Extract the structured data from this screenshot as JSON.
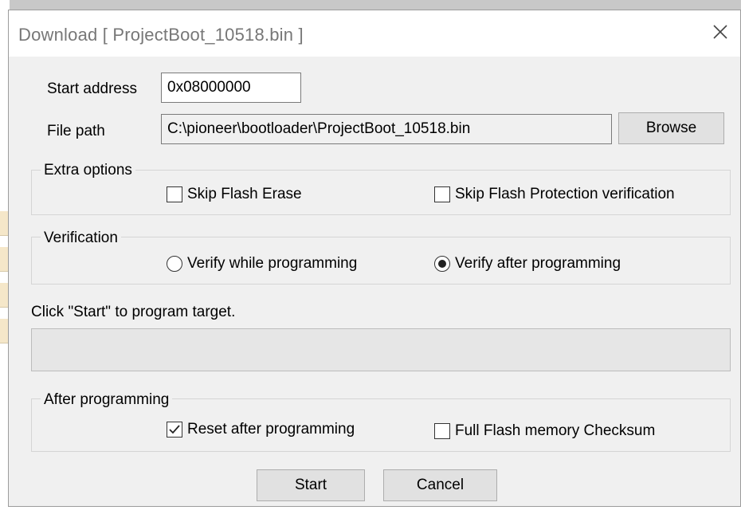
{
  "window": {
    "title": "Download [ ProjectBoot_10518.bin ]"
  },
  "start_address": {
    "label": "Start address",
    "value": "0x08000000"
  },
  "file_path": {
    "label": "File path",
    "value": "C:\\pioneer\\bootloader\\ProjectBoot_10518.bin",
    "browse_label": "Browse"
  },
  "extra_options": {
    "title": "Extra options",
    "skip_flash_erase": {
      "label": "Skip Flash Erase",
      "checked": false
    },
    "skip_protection": {
      "label": "Skip Flash Protection verification",
      "checked": false
    }
  },
  "verification": {
    "title": "Verification",
    "while": {
      "label": "Verify while programming",
      "selected": false
    },
    "after": {
      "label": "Verify after programming",
      "selected": true
    }
  },
  "status": {
    "text": "Click \"Start\" to program target.",
    "progress": 0
  },
  "after_programming": {
    "title": "After programming",
    "reset": {
      "label": "Reset after programming",
      "checked": true
    },
    "checksum": {
      "label": "Full Flash memory Checksum",
      "checked": false
    }
  },
  "buttons": {
    "start": "Start",
    "cancel": "Cancel"
  }
}
